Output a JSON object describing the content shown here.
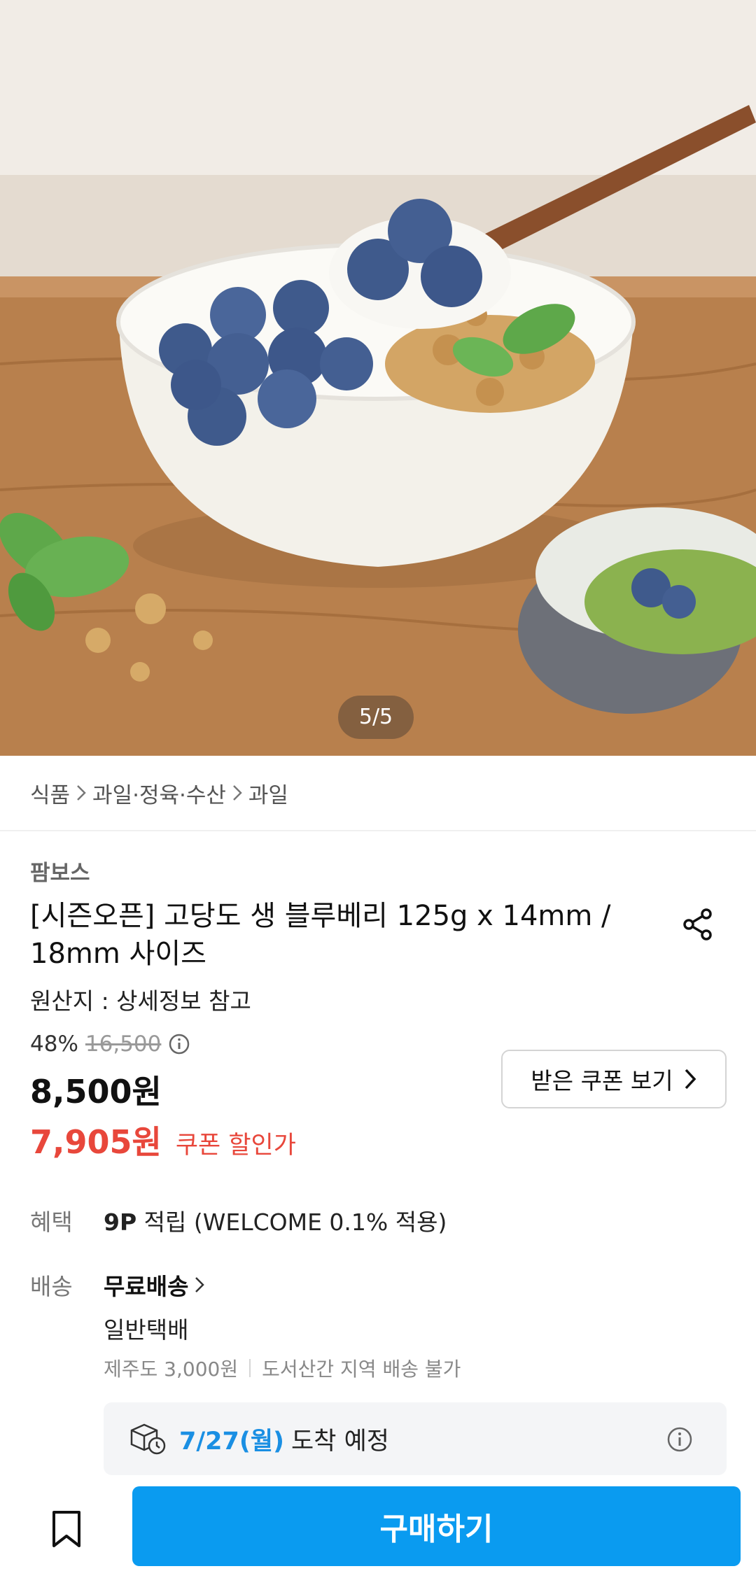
{
  "hero": {
    "image_description_icon": "product-photo",
    "counter": "5/5"
  },
  "breadcrumb": [
    "식품",
    "과일·정육·수산",
    "과일"
  ],
  "product": {
    "brand": "팜보스",
    "title": "[시즌오픈] 고당도 생 블루베리  125g x 14mm / 18mm 사이즈",
    "origin": "원산지 : 상세정보 참고",
    "discount": "48%",
    "original_price": "16,500",
    "price": "8,500원",
    "coupon_price": "7,905원",
    "coupon_label": "쿠폰 할인가",
    "coupon_button": "받은 쿠폰 보기"
  },
  "benefit": {
    "label": "혜택",
    "points": "9P",
    "text": " 적립 (WELCOME 0.1% 적용)"
  },
  "shipping": {
    "label": "배송",
    "main": "무료배송",
    "type": "일반택배",
    "jeju": "제주도 3,000원",
    "island": "도서산간 지역 배송 불가",
    "arrival_date": "7/27(월)",
    "arrival_text": "도착 예정"
  },
  "bottom": {
    "buy_label": "구매하기"
  },
  "colors": {
    "accent_blue": "#0a9bf0",
    "sale_red": "#e8473b",
    "arrival_blue": "#1a8fe3"
  }
}
